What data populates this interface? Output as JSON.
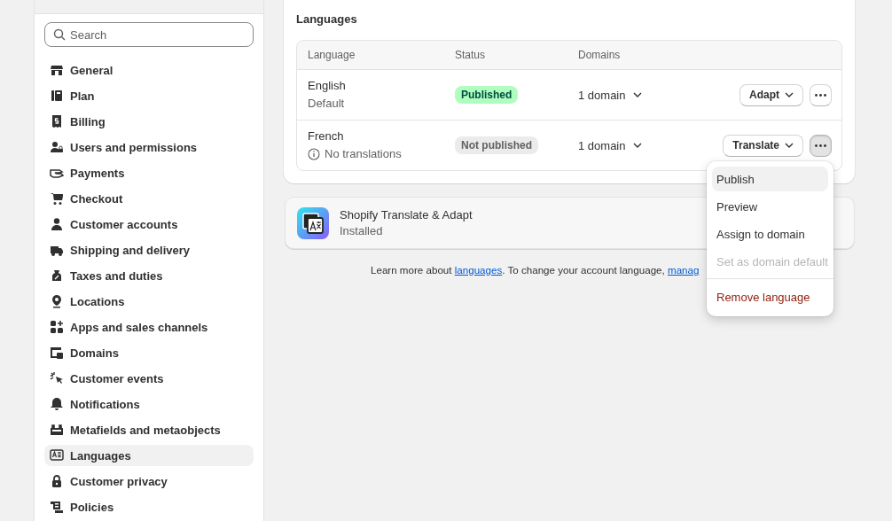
{
  "sidebar": {
    "search": {
      "placeholder": "Search"
    },
    "items": [
      {
        "label": "General",
        "selected": false
      },
      {
        "label": "Plan",
        "selected": false
      },
      {
        "label": "Billing",
        "selected": false
      },
      {
        "label": "Users and permissions",
        "selected": false
      },
      {
        "label": "Payments",
        "selected": false
      },
      {
        "label": "Checkout",
        "selected": false
      },
      {
        "label": "Customer accounts",
        "selected": false
      },
      {
        "label": "Shipping and delivery",
        "selected": false
      },
      {
        "label": "Taxes and duties",
        "selected": false
      },
      {
        "label": "Locations",
        "selected": false
      },
      {
        "label": "Apps and sales channels",
        "selected": false
      },
      {
        "label": "Domains",
        "selected": false
      },
      {
        "label": "Customer events",
        "selected": false
      },
      {
        "label": "Notifications",
        "selected": false
      },
      {
        "label": "Metafields and metaobjects",
        "selected": false
      },
      {
        "label": "Languages",
        "selected": true
      },
      {
        "label": "Customer privacy",
        "selected": false
      },
      {
        "label": "Policies",
        "selected": false
      }
    ]
  },
  "languages_card": {
    "title": "Languages",
    "columns": [
      "Language",
      "Status",
      "Domains"
    ],
    "rows": [
      {
        "name": "English",
        "note": "Default",
        "info_icon": false,
        "status": {
          "label": "Published",
          "color": "#affebf"
        },
        "domains": "1 domain",
        "action": "Adapt",
        "more_active": false
      },
      {
        "name": "French",
        "note": "No translations",
        "info_icon": true,
        "status": {
          "label": "Not published",
          "color": "#ebebeb"
        },
        "domains": "1 domain",
        "action": "Translate",
        "more_active": true
      }
    ]
  },
  "app_card": {
    "name": "Shopify Translate & Adapt",
    "status": "Installed"
  },
  "footer": {
    "text_before": "Learn more about ",
    "link": "languages",
    "text_middle": ". To change your account language, ",
    "link_2": "manag"
  },
  "menu": {
    "items": [
      {
        "label": "Publish",
        "kind": "normal",
        "selected": true,
        "disabled": false
      },
      {
        "label": "Preview",
        "kind": "normal",
        "selected": false,
        "disabled": false
      },
      {
        "label": "Assign to domain",
        "kind": "normal",
        "selected": false,
        "disabled": false
      },
      {
        "label": "Set as domain default",
        "kind": "normal",
        "selected": false,
        "disabled": true
      },
      {
        "label": "Remove language",
        "kind": "destructive",
        "selected": false,
        "disabled": false
      }
    ]
  }
}
